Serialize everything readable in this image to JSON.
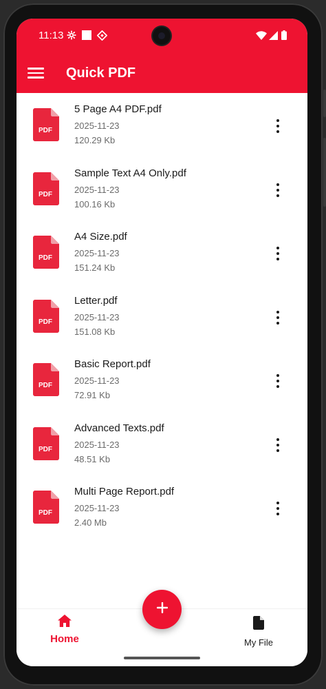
{
  "status_bar": {
    "time": "11:13",
    "icons": [
      "gear-icon",
      "square-icon",
      "diamond-icon",
      "wifi-icon",
      "signal-icon",
      "battery-icon"
    ]
  },
  "app_bar": {
    "title": "Quick PDF",
    "menu_icon": "hamburger-menu-icon"
  },
  "files": [
    {
      "name": "5 Page A4 PDF.pdf",
      "date": "2025-11-23",
      "size": "120.29 Kb",
      "icon_label": "PDF"
    },
    {
      "name": "Sample Text A4 Only.pdf",
      "date": "2025-11-23",
      "size": "100.16 Kb",
      "icon_label": "PDF"
    },
    {
      "name": "A4 Size.pdf",
      "date": "2025-11-23",
      "size": "151.24 Kb",
      "icon_label": "PDF"
    },
    {
      "name": "Letter.pdf",
      "date": "2025-11-23",
      "size": "151.08 Kb",
      "icon_label": "PDF"
    },
    {
      "name": "Basic Report.pdf",
      "date": "2025-11-23",
      "size": "72.91 Kb",
      "icon_label": "PDF"
    },
    {
      "name": "Advanced Texts.pdf",
      "date": "2025-11-23",
      "size": "48.51 Kb",
      "icon_label": "PDF"
    },
    {
      "name": "Multi Page Report.pdf",
      "date": "2025-11-23",
      "size": "2.40 Mb",
      "icon_label": "PDF"
    }
  ],
  "bottom_nav": {
    "home_label": "Home",
    "file_label": "My File",
    "active": "Home"
  },
  "fab": {
    "icon": "plus-icon"
  },
  "colors": {
    "accent": "#ee1331",
    "text": "#1a1a1a",
    "muted": "#6b6b6b"
  }
}
